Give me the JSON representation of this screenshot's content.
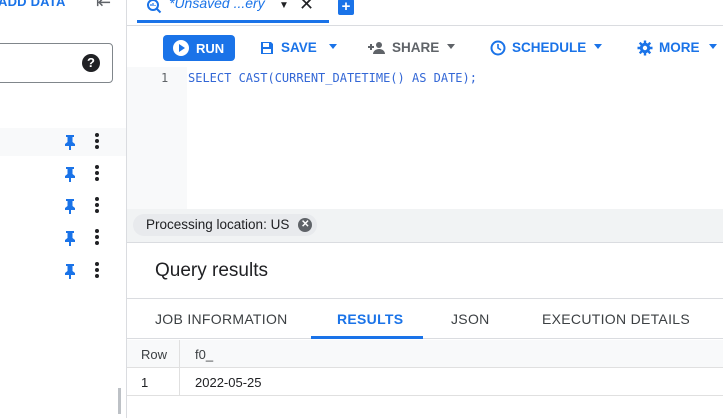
{
  "left_panel": {
    "add_data_label": "ADD DATA",
    "collapse_icon": "collapse-panel-icon",
    "search_help_icon": "?",
    "rows": [
      {
        "pin_icon": "pin-icon",
        "menu_icon": "more-vert-icon"
      },
      {
        "pin_icon": "pin-icon",
        "menu_icon": "more-vert-icon"
      },
      {
        "pin_icon": "pin-icon",
        "menu_icon": "more-vert-icon"
      },
      {
        "pin_icon": "pin-icon",
        "menu_icon": "more-vert-icon"
      },
      {
        "pin_icon": "pin-icon",
        "menu_icon": "more-vert-icon"
      }
    ]
  },
  "tabs": {
    "active_tab_label": "*Unsaved ...ery",
    "close_glyph": "✕",
    "add_glyph": "+"
  },
  "toolbar": {
    "run_label": "RUN",
    "save_label": "SAVE",
    "share_label": "SHARE",
    "schedule_label": "SCHEDULE",
    "more_label": "MORE"
  },
  "editor": {
    "line_number": "1",
    "code": "SELECT CAST(CURRENT_DATETIME() AS DATE);",
    "processing_location": "Processing location: US"
  },
  "results": {
    "title": "Query results",
    "tabs": [
      {
        "label": "JOB INFORMATION",
        "active": false
      },
      {
        "label": "RESULTS",
        "active": true
      },
      {
        "label": "JSON",
        "active": false
      },
      {
        "label": "EXECUTION DETAILS",
        "active": false
      }
    ],
    "columns": [
      "Row",
      "f0_"
    ],
    "rows": [
      [
        "1",
        "2022-05-25"
      ]
    ]
  },
  "colors": {
    "accent": "#1a73e8",
    "text": "#202124",
    "muted": "#5f6368"
  }
}
